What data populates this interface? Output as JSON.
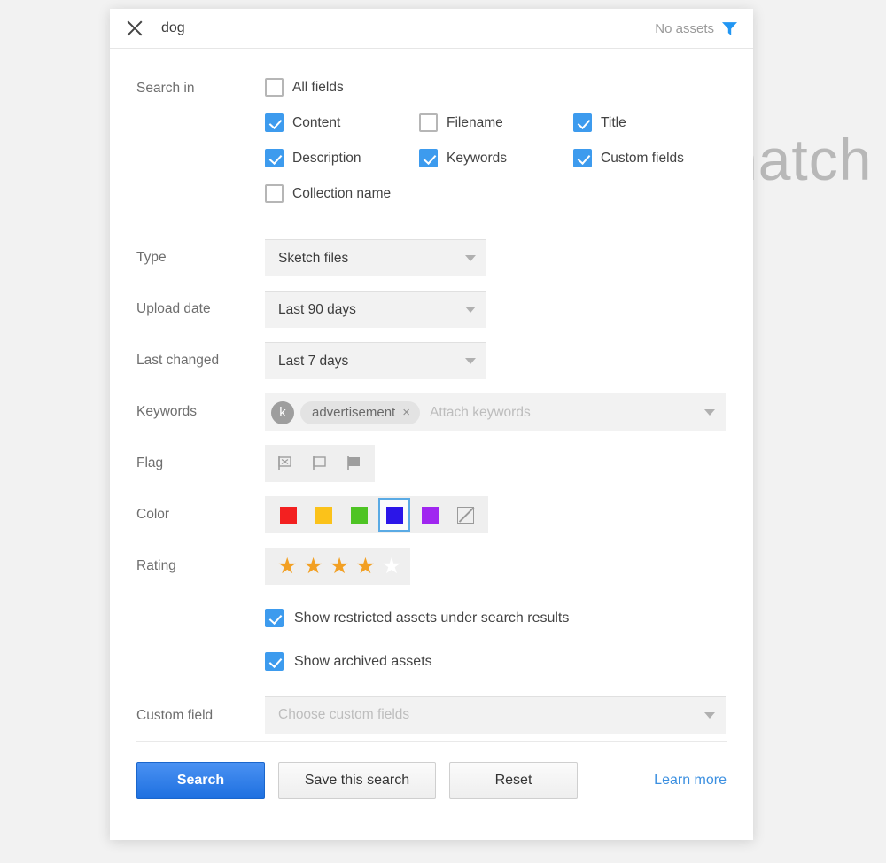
{
  "background": {
    "watermark_text": "natch"
  },
  "header": {
    "close_icon": "close-icon",
    "query": "dog",
    "assets_status": "No assets",
    "filter_icon": "funnel-icon"
  },
  "search_in": {
    "label": "Search in",
    "options": [
      {
        "label": "All fields",
        "checked": false
      },
      {
        "label": "Content",
        "checked": true
      },
      {
        "label": "Filename",
        "checked": false
      },
      {
        "label": "Title",
        "checked": true
      },
      {
        "label": "Description",
        "checked": true
      },
      {
        "label": "Keywords",
        "checked": true
      },
      {
        "label": "Custom fields",
        "checked": true
      },
      {
        "label": "Collection name",
        "checked": false
      }
    ]
  },
  "fields": {
    "type": {
      "label": "Type",
      "value": "Sketch files"
    },
    "upload_date": {
      "label": "Upload date",
      "value": "Last 90 days"
    },
    "last_changed": {
      "label": "Last changed",
      "value": "Last 7 days"
    },
    "keywords": {
      "label": "Keywords",
      "avatar_initial": "k",
      "chips": [
        {
          "text": "advertisement",
          "remove": "×"
        }
      ],
      "placeholder": "Attach keywords"
    },
    "flag": {
      "label": "Flag",
      "buttons": [
        {
          "name": "flag-rejected-icon",
          "state": "rejected"
        },
        {
          "name": "flag-unflagged-icon",
          "state": "unflagged"
        },
        {
          "name": "flag-flagged-icon",
          "state": "flagged"
        }
      ]
    },
    "color": {
      "label": "Color",
      "swatches": [
        {
          "name": "color-red",
          "hex": "#f32020",
          "selected": false
        },
        {
          "name": "color-yellow",
          "hex": "#fbc21a",
          "selected": false
        },
        {
          "name": "color-green",
          "hex": "#4ec424",
          "selected": false
        },
        {
          "name": "color-blue",
          "hex": "#2b15e8",
          "selected": true
        },
        {
          "name": "color-purple",
          "hex": "#a026f0",
          "selected": false
        },
        {
          "name": "color-none",
          "hex": "none",
          "selected": false
        }
      ]
    },
    "rating": {
      "label": "Rating",
      "value": 4,
      "max": 5,
      "filled_color": "#f2a024",
      "empty_color": "#ffffff"
    },
    "custom_field": {
      "label": "Custom field",
      "placeholder": "Choose custom fields"
    }
  },
  "toggles": [
    {
      "label": "Show restricted assets under search results",
      "checked": true
    },
    {
      "label": "Show archived assets",
      "checked": true
    }
  ],
  "footer": {
    "search_label": "Search",
    "save_label": "Save this search",
    "reset_label": "Reset",
    "learn_more_label": "Learn more"
  },
  "colors": {
    "accent_blue": "#3d9bee",
    "primary_button": "#1e70e0",
    "link": "#3b8fe0"
  }
}
